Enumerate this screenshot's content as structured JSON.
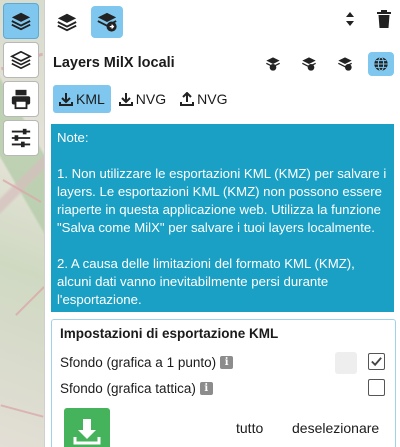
{
  "panel": {
    "title": "Layers MilX locali"
  },
  "formats": [
    {
      "label": "KML",
      "active": true
    },
    {
      "label": "NVG",
      "active": false
    },
    {
      "label": "NVG",
      "active": false
    }
  ],
  "note": {
    "heading": "Note:",
    "p1": "1. Non utilizzare le esportazioni KML (KMZ) per salvare i layers. Le esportazioni KML (KMZ) non possono essere riaperte in questa applicazione web. Utilizza la funzione \"Salva come MilX\" per salvare i tuoi layers localmente.",
    "p2": "2. A causa delle limitazioni del formato KML (KMZ), alcuni dati vanno inevitabilmente persi durante l'esportazione."
  },
  "settings": {
    "title": "Impostazioni di esportazione KML",
    "background_point": "Sfondo (grafica a 1 punto)",
    "background_point_checked": true,
    "background_tactical": "Sfondo (grafica tattica)",
    "background_tactical_checked": false,
    "select_all": "tutto",
    "deselect": "deselezionare"
  },
  "colors": {
    "accent": "#7fc7ef",
    "note_bg": "#1aa0c4",
    "download_btn": "#44b35b"
  }
}
